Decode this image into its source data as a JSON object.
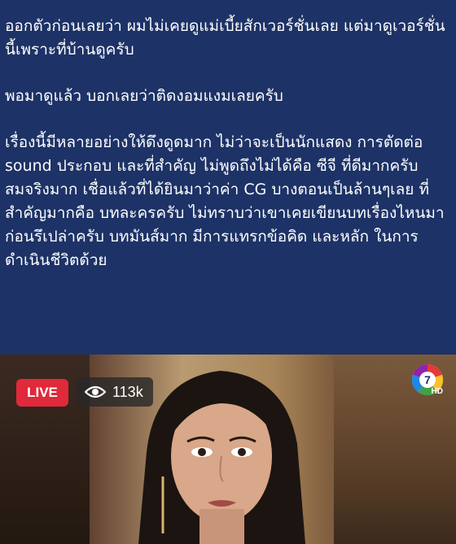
{
  "post": {
    "paragraphs": [
      "ออกตัวก่อนเลยว่า ผมไม่เคยดูแม่เบี้ยสักเวอร์ชั่นเลย แต่มาดูเวอร์ชั่นนี้เพราะที่บ้านดูครับ",
      "พอมาดูแล้ว บอกเลยว่าติดงอมแงมเลยครับ",
      "เรื่องนี้มีหลายอย่างให้ดึงดูดมาก ไม่ว่าจะเป็นนักแสดง การตัดต่อ sound ประกอบ และที่สำคัญ ไม่พูดถึงไม่ได้คือ ซีจี ที่ดีมากครับ สมจริงมาก เชื่อแล้วที่ได้ยินมาว่าค่า CG บางตอนเป็นล้านๆเลย ที่สำคัญมากคือ บทละครครับ ไม่ทราบว่าเขาเคยเขียนบทเรื่องไหนมาก่อนรึเปล่าครับ บทมันส์มาก มีการแทรกข้อคิด และหลัก ในการดำเนินชีวิตด้วย"
    ]
  },
  "video": {
    "live_label": "LIVE",
    "viewer_count": "113k",
    "channel_logo_icon": "channel-7-logo",
    "channel_hd": "HD",
    "colors": {
      "live": "#e0293a",
      "background": "#1d3266"
    }
  }
}
